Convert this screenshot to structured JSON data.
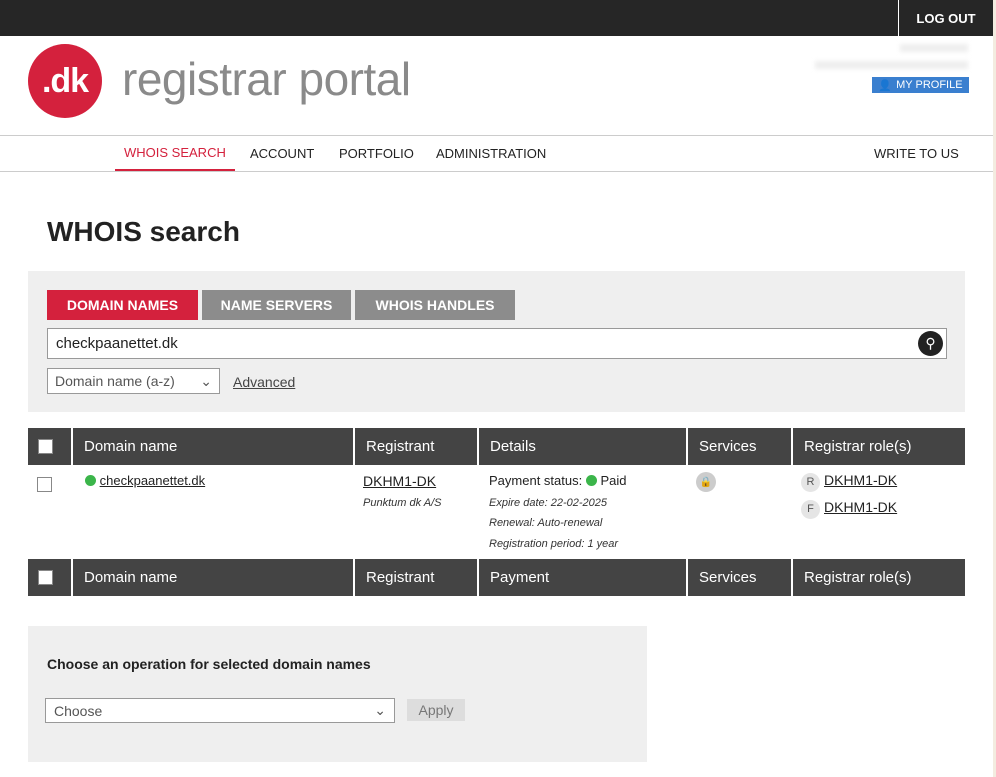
{
  "header": {
    "logout": "LOG OUT",
    "logo_text": ".dk",
    "portal_title": "registrar portal",
    "my_profile": "MY PROFILE"
  },
  "nav": {
    "items": [
      "WHOIS SEARCH",
      "ACCOUNT",
      "PORTFOLIO",
      "ADMINISTRATION"
    ],
    "write_to_us": "WRITE TO US"
  },
  "page_title": "WHOIS search",
  "search": {
    "tabs": [
      "DOMAIN NAMES",
      "NAME SERVERS",
      "WHOIS HANDLES"
    ],
    "active_tab": "DOMAIN NAMES",
    "query": "checkpaanettet.dk",
    "sort": "Domain name (a-z)",
    "advanced": "Advanced"
  },
  "table": {
    "headers": [
      "Domain name",
      "Registrant",
      "Details",
      "Services",
      "Registrar role(s)"
    ],
    "footer_headers": [
      "Domain name",
      "Registrant",
      "Payment",
      "Services",
      "Registrar role(s)"
    ],
    "rows": [
      {
        "domain": "checkpaanettet.dk",
        "registrant_handle": "DKHM1-DK",
        "registrant_name": "Punktum dk A/S",
        "payment_label": "Payment status:",
        "payment_status": "Paid",
        "expire": "Expire date: 22-02-2025",
        "renewal": "Renewal: Auto-renewal",
        "period": "Registration period: 1 year",
        "roles": [
          {
            "letter": "R",
            "handle": "DKHM1-DK"
          },
          {
            "letter": "F",
            "handle": "DKHM1-DK"
          }
        ]
      }
    ]
  },
  "operations": {
    "title": "Choose an operation for selected domain names",
    "select": "Choose",
    "apply": "Apply"
  },
  "colors": {
    "brand": "#d4213d",
    "profile": "#3a7fcf",
    "status_ok": "#3bb54a"
  }
}
